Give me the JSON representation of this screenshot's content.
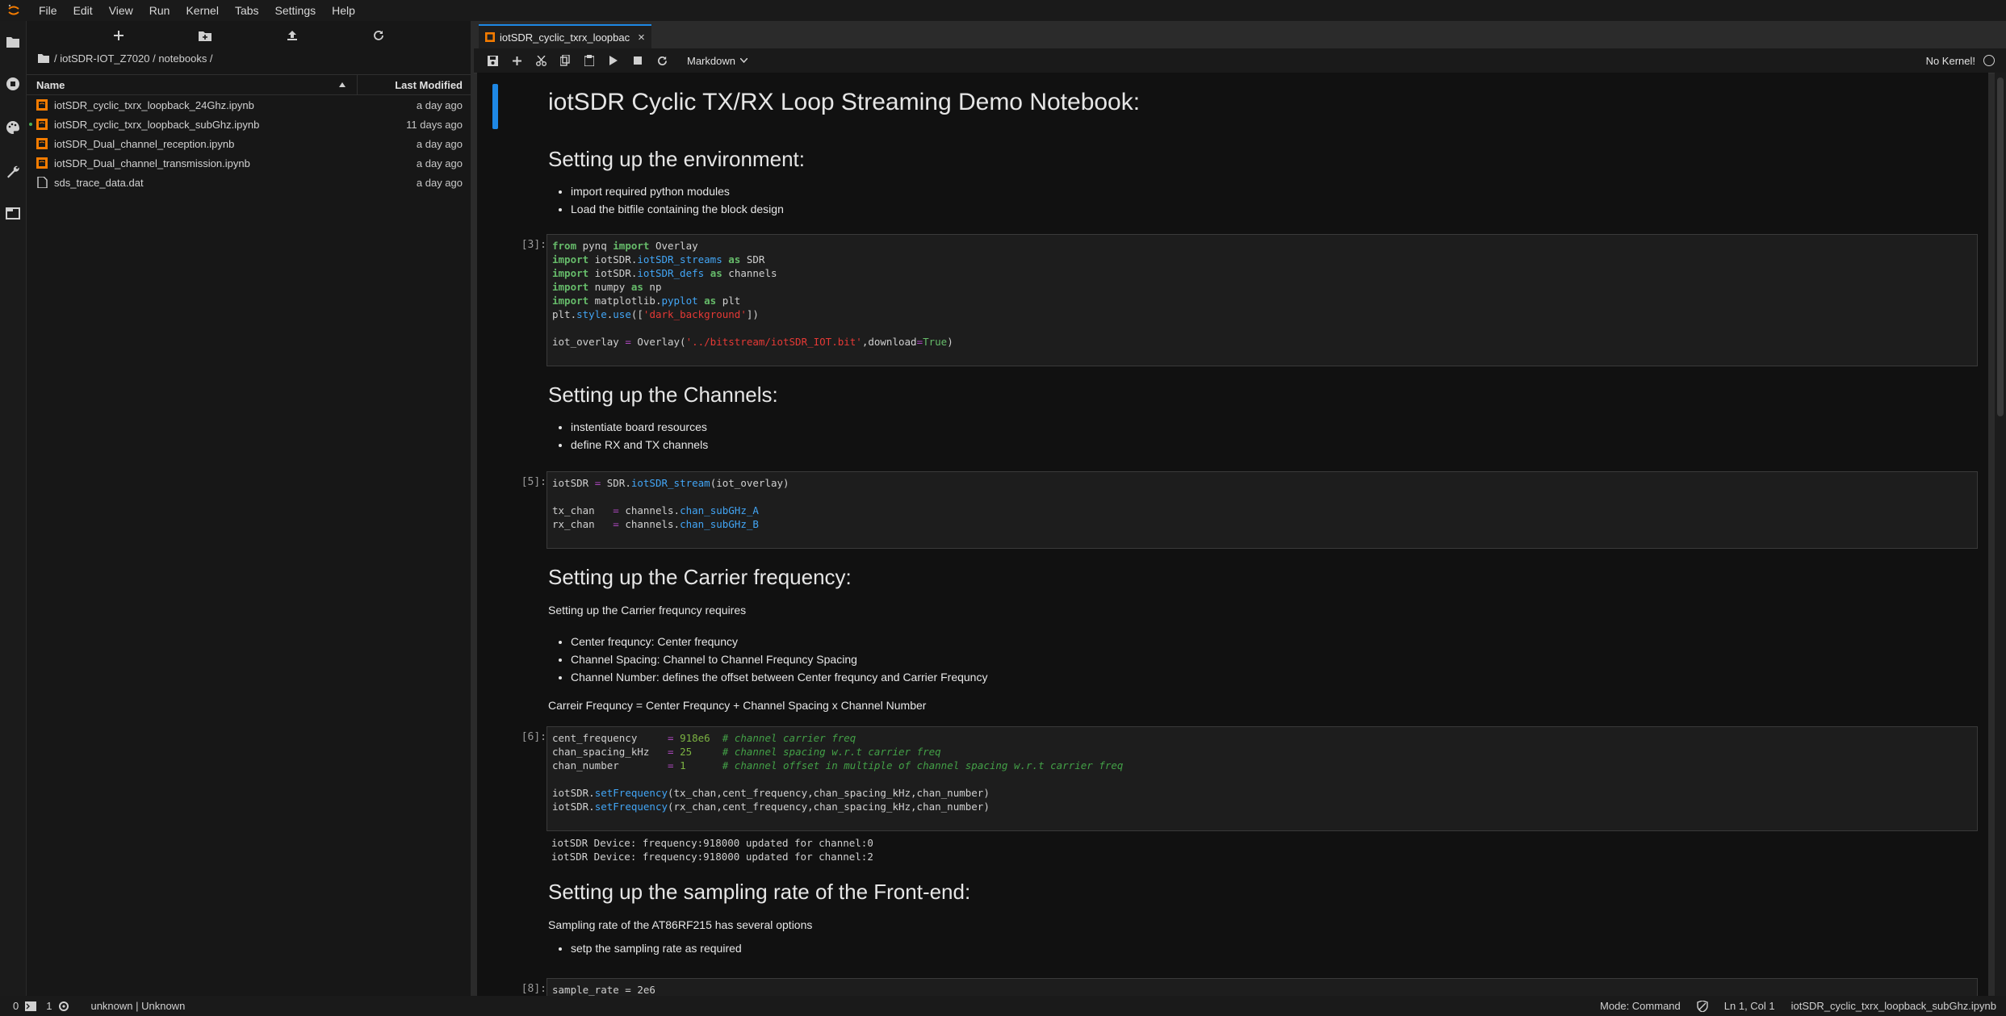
{
  "menu": [
    "File",
    "Edit",
    "View",
    "Run",
    "Kernel",
    "Tabs",
    "Settings",
    "Help"
  ],
  "filebrowser": {
    "breadcrumb": "/ iotSDR-IOT_Z7020 / notebooks /",
    "col_name": "Name",
    "col_modified": "Last Modified",
    "files": [
      {
        "name": "iotSDR_cyclic_txrx_loopback_24Ghz.ipynb",
        "modified": "a day ago",
        "type": "notebook",
        "running": false
      },
      {
        "name": "iotSDR_cyclic_txrx_loopback_subGhz.ipynb",
        "modified": "11 days ago",
        "type": "notebook",
        "running": true
      },
      {
        "name": "iotSDR_Dual_channel_reception.ipynb",
        "modified": "a day ago",
        "type": "notebook",
        "running": false
      },
      {
        "name": "iotSDR_Dual_channel_transmission.ipynb",
        "modified": "a day ago",
        "type": "notebook",
        "running": false
      },
      {
        "name": "sds_trace_data.dat",
        "modified": "a day ago",
        "type": "file",
        "running": false
      }
    ]
  },
  "notebook": {
    "tab_title": "iotSDR_cyclic_txrx_loopbac",
    "cell_type": "Markdown",
    "kernel": "No Kernel!",
    "title": "iotSDR Cyclic TX/RX Loop Streaming Demo Notebook:",
    "env_heading": "Setting up the environment:",
    "env_bullets": [
      "import required python modules",
      "Load the bitfile containing the block design"
    ],
    "prompt1": "[3]:",
    "chan_heading": "Setting up the Channels:",
    "chan_bullets": [
      "instentiate board resources",
      "define RX and TX channels"
    ],
    "prompt2": "[5]:",
    "freq_heading": "Setting up the Carrier frequency:",
    "freq_intro": "Setting up the Carrier frequncy requires",
    "freq_bullets": [
      "Center frequncy: Center frequncy",
      "Channel Spacing: Channel to Channel Frequncy Spacing",
      "Channel Number: defines the offset between Center frequncy and Carrier Frequncy"
    ],
    "freq_formula": "Carreir Frequncy = Center Frequncy + Channel Spacing x Channel Number",
    "prompt3": "[6]:",
    "output3": [
      "iotSDR Device: frequency:918000 updated for channel:0",
      "iotSDR Device: frequency:918000 updated for channel:2"
    ],
    "rate_heading": "Setting up the sampling rate of the Front-end:",
    "rate_intro": "Sampling rate of the AT86RF215 has several options",
    "rate_bullets": [
      "setp the sampling rate as required"
    ],
    "prompt4": "[8]:",
    "code4_partial": "sample_rate = 2e6"
  },
  "statusbar": {
    "count_a": "0",
    "count_b": "1",
    "kernel_info": "unknown | Unknown",
    "mode": "Mode: Command",
    "position": "Ln 1, Col 1",
    "filename": "iotSDR_cyclic_txrx_loopback_subGhz.ipynb"
  },
  "colors": {
    "accent": "#1e88e5",
    "notebook_icon": "#f57c00",
    "keyword": "#66bb6a",
    "string": "#e53935",
    "module": "#42a5f5"
  }
}
